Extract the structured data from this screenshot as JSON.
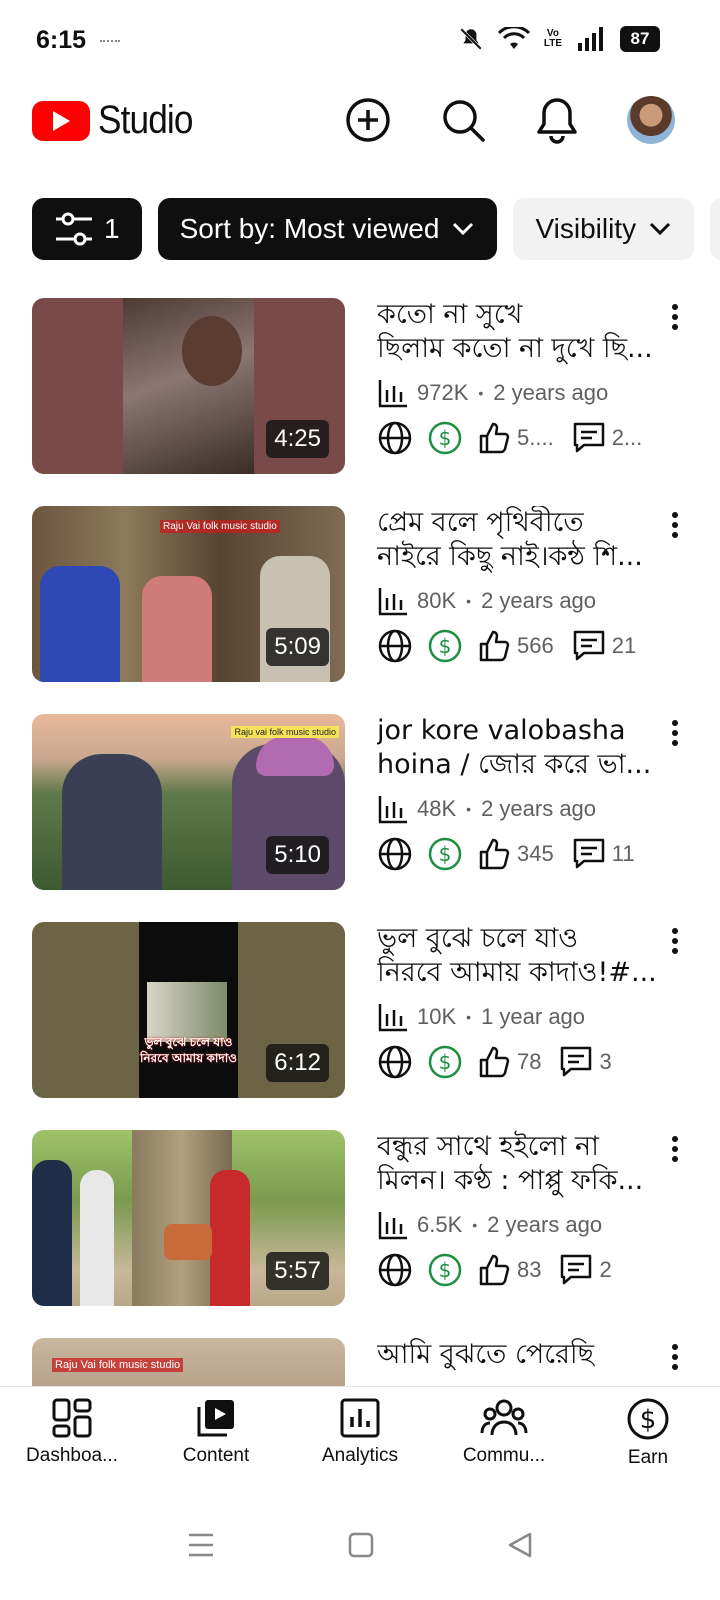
{
  "status": {
    "time": "6:15",
    "battery": "87",
    "network": "Vo LTE"
  },
  "header": {
    "brand": "Studio"
  },
  "chips": [
    {
      "label": "1",
      "kind": "filter"
    },
    {
      "label": "Sort by: Most viewed",
      "kind": "sort"
    },
    {
      "label": "Visibility",
      "kind": "visibility"
    }
  ],
  "videos": [
    {
      "title_l1": "কতো না সুখে",
      "title_l2": "ছিলাম কতো না দুখে ছি...",
      "duration": "4:25",
      "views": "972K",
      "age": "2 years ago",
      "likes": "5....",
      "comments": "2..."
    },
    {
      "title_l1": "প্রেম বলে পৃথিবীতে",
      "title_l2": "নাইরে কিছু নাই।কন্ঠ শি...",
      "duration": "5:09",
      "views": "80K",
      "age": "2 years ago",
      "likes": "566",
      "comments": "21"
    },
    {
      "title_l1": "jor kore valobasha",
      "title_l2": "hoina / জোর করে ভা...",
      "duration": "5:10",
      "views": "48K",
      "age": "2 years ago",
      "likes": "345",
      "comments": "11"
    },
    {
      "title_l1": "ভুল বুঝে চলে যাও",
      "title_l2": "নিরবে আমায় কাদাও!#...",
      "duration": "6:12",
      "views": "10K",
      "age": "1 year ago",
      "likes": "78",
      "comments": "3"
    },
    {
      "title_l1": "বন্ধুর সাথে হইলো না",
      "title_l2": "মিলন। কণ্ঠ : পাপ্পু ফকি...",
      "duration": "5:57",
      "views": "6.5K",
      "age": "2 years ago",
      "likes": "83",
      "comments": "2"
    },
    {
      "title_l1": "আমি বুঝতে পেরেছি",
      "title_l2": "",
      "duration": "",
      "views": "",
      "age": "",
      "likes": "",
      "comments": ""
    }
  ],
  "thumb_texts": {
    "v2_overlay": "Raju Vai folk music studio",
    "v3_overlay": "Raju vai folk music studio",
    "v4_overlay": "ভুল বুঝে চলে যাও নিরবে আমায় কাদাও",
    "v6_overlay": "Raju Vai folk music studio"
  },
  "bottom_nav": [
    {
      "label": "Dashboa...",
      "icon": "dashboard-icon"
    },
    {
      "label": "Content",
      "icon": "content-icon"
    },
    {
      "label": "Analytics",
      "icon": "analytics-icon"
    },
    {
      "label": "Commu...",
      "icon": "community-icon"
    },
    {
      "label": "Earn",
      "icon": "earn-icon"
    }
  ],
  "colors": {
    "brand_red": "#ff0000",
    "monetized_green": "#1e8e3e",
    "text": "#0f0f0f",
    "secondary_text": "#606060"
  }
}
